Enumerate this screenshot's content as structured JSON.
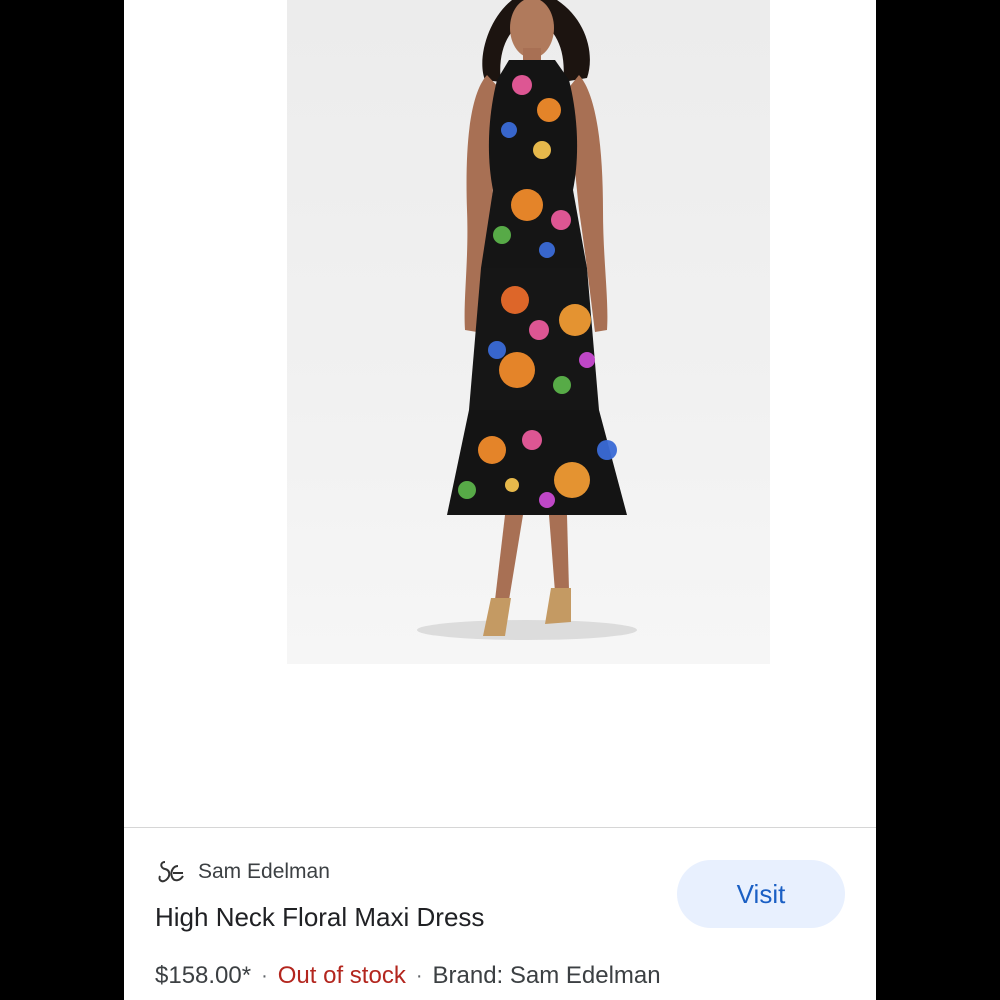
{
  "product": {
    "image_icon": "product-photo-floral-maxi-dress",
    "brand_logo_icon": "sam-edelman-logo-icon",
    "brand_name": "Sam Edelman",
    "title": "High Neck Floral Maxi Dress",
    "price": "$158.00*",
    "separator_1": "·",
    "stock_status": "Out of stock",
    "separator_2": "·",
    "brand_label": "Brand: Sam Edelman"
  },
  "actions": {
    "visit_label": "Visit"
  },
  "colors": {
    "visit_bg": "#e8f0fe",
    "visit_text": "#1a5fc4",
    "out_of_stock": "#b3261e"
  }
}
